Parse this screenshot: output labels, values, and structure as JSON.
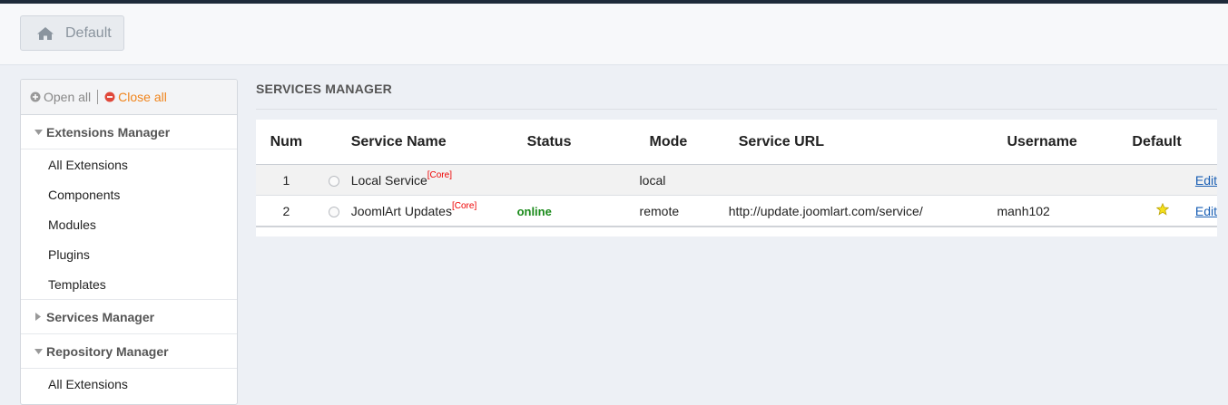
{
  "header": {
    "home_label": "Default"
  },
  "sidebar": {
    "open_all": "Open all",
    "close_all": "Close all",
    "groups": [
      {
        "label": "Extensions Manager",
        "expanded": true,
        "items": [
          "All Extensions",
          "Components",
          "Modules",
          "Plugins",
          "Templates"
        ]
      },
      {
        "label": "Services Manager",
        "expanded": false,
        "items": []
      },
      {
        "label": "Repository Manager",
        "expanded": true,
        "items": [
          "All Extensions"
        ]
      }
    ]
  },
  "main": {
    "title": "SERVICES MANAGER",
    "columns": [
      "Num",
      "Service Name",
      "Status",
      "Mode",
      "Service URL",
      "Username",
      "Default"
    ],
    "rows": [
      {
        "num": "1",
        "name": "Local Service",
        "tag": "[Core]",
        "status": "",
        "mode": "local",
        "url": "",
        "username": "",
        "default": false,
        "action": "Edit"
      },
      {
        "num": "2",
        "name": "JoomlArt Updates",
        "tag": "[Core]",
        "status": "online",
        "mode": "remote",
        "url": "http://update.joomlart.com/service/",
        "username": "manh102",
        "default": true,
        "action": "Edit"
      }
    ]
  },
  "colors": {
    "accent_orange": "#f0841b",
    "online_green": "#1a8a1a",
    "core_red": "#e00000",
    "link_blue": "#1a5fb4"
  }
}
